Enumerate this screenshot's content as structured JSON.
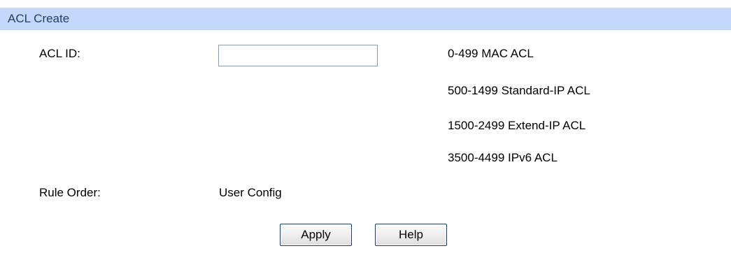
{
  "section": {
    "title": "ACL Create"
  },
  "form": {
    "acl_id_label": "ACL ID:",
    "acl_id_value": "",
    "acl_id_ranges": [
      "0-499 MAC ACL",
      "500-1499 Standard-IP ACL",
      "1500-2499 Extend-IP ACL",
      "3500-4499 IPv6 ACL"
    ],
    "rule_order_label": "Rule Order:",
    "rule_order_value": "User Config"
  },
  "buttons": {
    "apply_label": "Apply",
    "help_label": "Help"
  },
  "colors": {
    "header_background": "#c5d8f9",
    "header_text": "#1f3f66",
    "button_border": "#1f3a5c",
    "input_border": "#8d9bac"
  }
}
